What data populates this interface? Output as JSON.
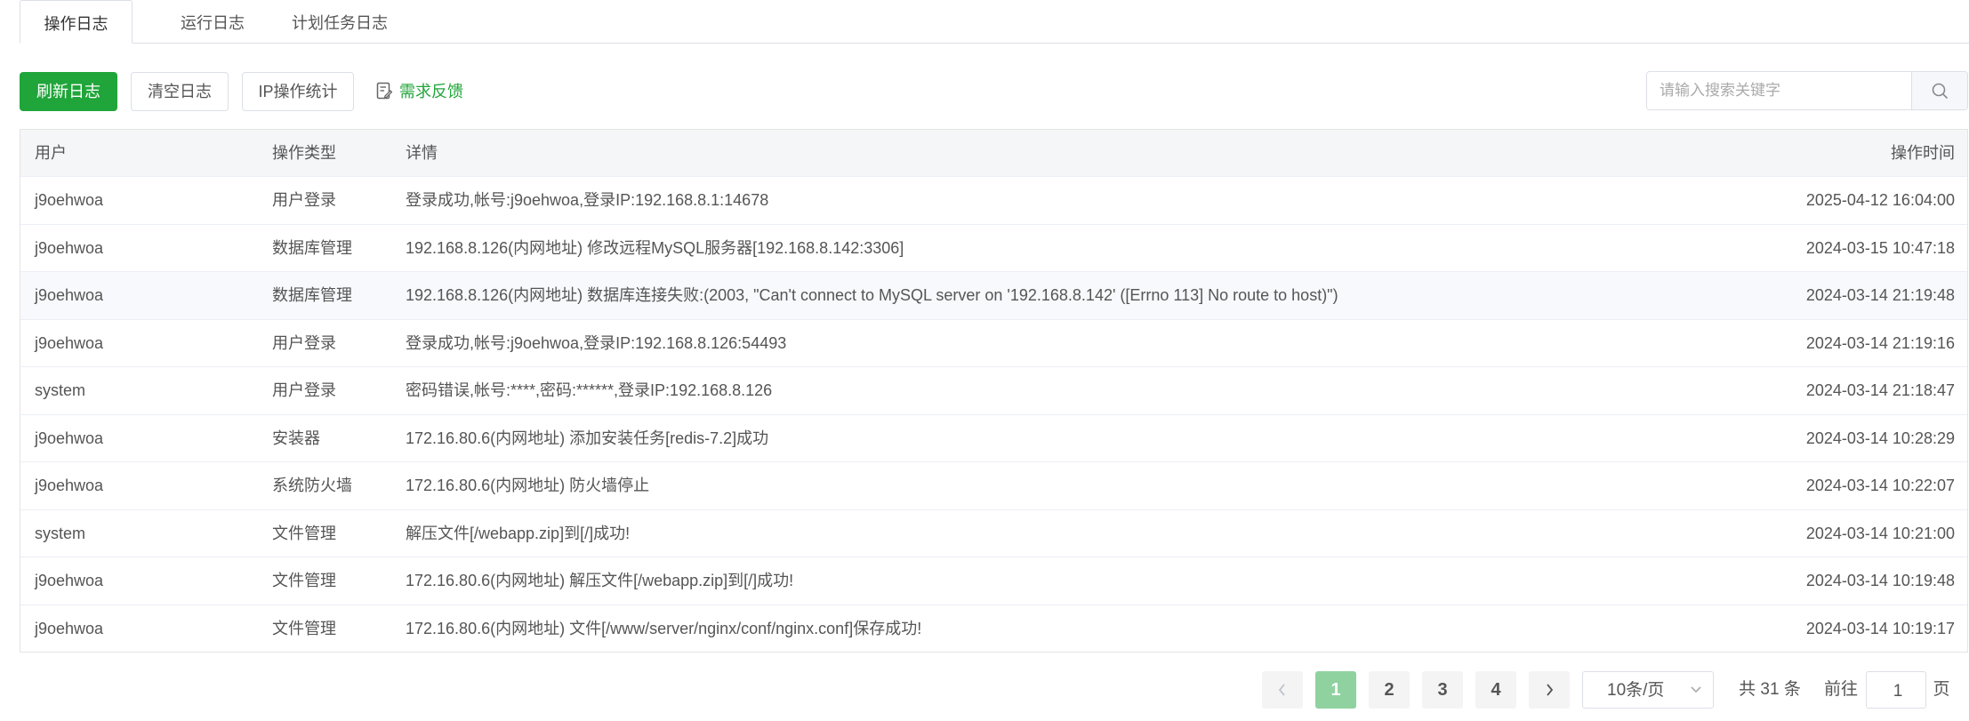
{
  "tabs": [
    {
      "label": "操作日志",
      "active": true
    },
    {
      "label": "运行日志",
      "active": false
    },
    {
      "label": "计划任务日志",
      "active": false
    }
  ],
  "toolbar": {
    "refresh_label": "刷新日志",
    "clear_label": "清空日志",
    "ip_stats_label": "IP操作统计",
    "feedback_label": "需求反馈",
    "search_placeholder": "请输入搜索关键字",
    "accent_color": "#20a53a"
  },
  "table": {
    "headers": {
      "user": "用户",
      "type": "操作类型",
      "detail": "详情",
      "time": "操作时间"
    },
    "rows": [
      {
        "user": "j9oehwoa",
        "type": "用户登录",
        "detail": "登录成功,帐号:j9oehwoa,登录IP:192.168.8.1:14678",
        "time": "2025-04-12 16:04:00"
      },
      {
        "user": "j9oehwoa",
        "type": "数据库管理",
        "detail": "192.168.8.126(内网地址) 修改远程MySQL服务器[192.168.8.142:3306]",
        "time": "2024-03-15 10:47:18"
      },
      {
        "user": "j9oehwoa",
        "type": "数据库管理",
        "detail": "192.168.8.126(内网地址) 数据库连接失败:(2003, \"Can't connect to MySQL server on '192.168.8.142' ([Errno 113] No route to host)\")",
        "time": "2024-03-14 21:19:48"
      },
      {
        "user": "j9oehwoa",
        "type": "用户登录",
        "detail": "登录成功,帐号:j9oehwoa,登录IP:192.168.8.126:54493",
        "time": "2024-03-14 21:19:16"
      },
      {
        "user": "system",
        "type": "用户登录",
        "detail": "密码错误,帐号:****,密码:******,登录IP:192.168.8.126",
        "time": "2024-03-14 21:18:47"
      },
      {
        "user": "j9oehwoa",
        "type": "安装器",
        "detail": "172.16.80.6(内网地址) 添加安装任务[redis-7.2]成功",
        "time": "2024-03-14 10:28:29"
      },
      {
        "user": "j9oehwoa",
        "type": "系统防火墙",
        "detail": "172.16.80.6(内网地址) 防火墙停止",
        "time": "2024-03-14 10:22:07"
      },
      {
        "user": "system",
        "type": "文件管理",
        "detail": "解压文件[/webapp.zip]到[/]成功!",
        "time": "2024-03-14 10:21:00"
      },
      {
        "user": "j9oehwoa",
        "type": "文件管理",
        "detail": "172.16.80.6(内网地址) 解压文件[/webapp.zip]到[/]成功!",
        "time": "2024-03-14 10:19:48"
      },
      {
        "user": "j9oehwoa",
        "type": "文件管理",
        "detail": "172.16.80.6(内网地址) 文件[/www/server/nginx/conf/nginx.conf]保存成功!",
        "time": "2024-03-14 10:19:17"
      }
    ]
  },
  "pagination": {
    "prev_icon": "chevron-left-icon",
    "next_icon": "chevron-right-icon",
    "pages": [
      "1",
      "2",
      "3",
      "4"
    ],
    "current_page": "1",
    "page_size": "10条/页",
    "total_text": "共 31 条",
    "goto_label": "前往",
    "goto_value": "1",
    "page_unit": "页"
  }
}
